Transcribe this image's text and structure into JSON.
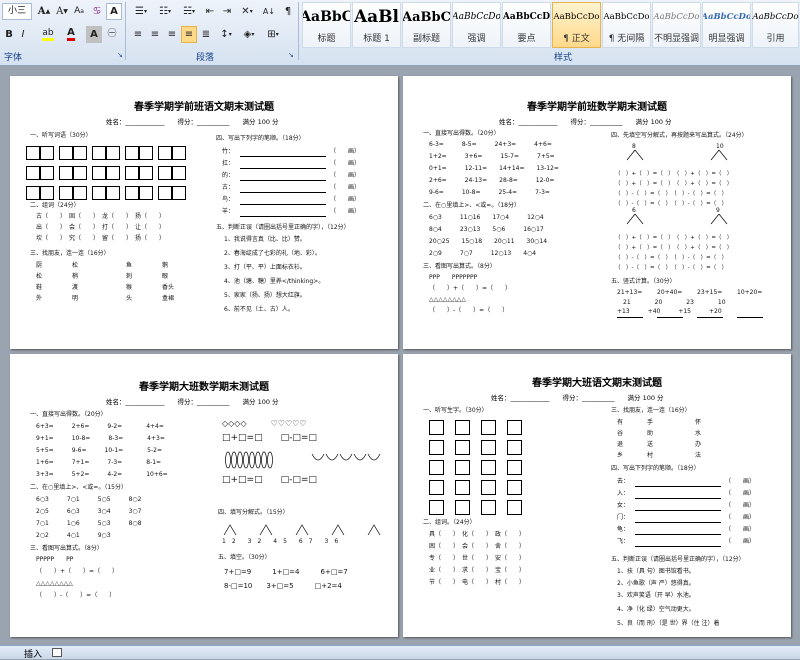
{
  "ribbon": {
    "font_size": "小三",
    "group_font": "字体",
    "group_paragraph": "段落",
    "group_styles": "样式",
    "styles": [
      {
        "preview": "AaBbC",
        "name": "标题"
      },
      {
        "preview": "AaBl",
        "name": "标题 1"
      },
      {
        "preview": "AaBbC",
        "name": "副标题"
      },
      {
        "preview": "AaBbCcDo",
        "name": "强调"
      },
      {
        "preview": "AaBbCcD",
        "name": "要点"
      },
      {
        "preview": "AaBbCcDo",
        "name": "正文"
      },
      {
        "preview": "AaBbCcDo",
        "name": "无间隔"
      },
      {
        "preview": "AaBbCcDo",
        "name": "不明显强调"
      },
      {
        "preview": "AaBbCcDo",
        "name": "明显强调"
      },
      {
        "preview": "AaBbCcDo",
        "name": "引用"
      }
    ],
    "selected_style": "正文"
  },
  "status": {
    "insert": "插入"
  },
  "page1": {
    "title": "春季学期学前班语文期末测试题",
    "info": [
      "姓名：",
      "得分：",
      "满分 100 分"
    ],
    "s1": "一、听写词语（30分）",
    "s2": "二、组词（24分）",
    "s2_rows": [
      "古（　　）　固（　　）　龙（　　）　扬（　　）",
      "出（　　）　会（　　）　打（　　）　让（　　）",
      "坎（　　）　究（　　）　留（　　）　扬（　　）"
    ],
    "s3": "三、找朋友，连一连（16分）",
    "s3_left": [
      "厨　　　　　松",
      "松　　　　　梢",
      "鞋　　　　　渡",
      "外　　　　　明"
    ],
    "s3_right": [
      "鱼　　　　　鹅",
      "刺　　　　　眼",
      "猴　　　　　香头",
      "头　　　　　盒裙"
    ],
    "s4": "四、写出下列字的笔顺。（18分）",
    "s4_chars": [
      "竹：",
      "扛：",
      "的：",
      "古：",
      "鸟：",
      "羊："
    ],
    "s4_tail": "（　　画）",
    "s5": "五、判断正误（请圈出括号里正确的字），（12分）",
    "s5_rows": [
      "1、我说得言真（比、比）赞。",
      "2、春海绽成了七彩的礼（地、彩）。",
      "3、打（平、平）上面标衣衫。",
      "4、池（塘、糖）里养</thinking>。",
      "5、家家（扬、扬）想大红旗。",
      "6、前不见（土、古）人。"
    ]
  },
  "page2": {
    "title": "春季学期学前班数学期末测试题",
    "info": [
      "姓名：",
      "得分：",
      "满分 100 分"
    ],
    "s1": "一、直接写出得数。（20分）",
    "s1_rows": [
      "6-3=　　　8-5=　　　24+3=　　　4+6=",
      "1+2=　　　3+6=　　　15-7=　　　7+5=",
      "0+1=　　　12-11=　　14+14=　　13-12=",
      "2+6=　　　24-13=　　28-8=　　　12-0=",
      "9-6=　　　10-8=　　　25-4=　　　7-3="
    ],
    "s2": "二、在○里填上>、<或=。（18分）",
    "s2_rows": [
      "6○3　　　11○16　　17○4　　　12○4",
      "8○4　　　23○13　　5○6　　　16○17",
      "20○25　　15○18　　20○11　　30○14",
      "2○9　　　7○7　　　12○13　　4○4"
    ],
    "s3": "三、看图写出算式。（8分）",
    "s3_rows": [
      "PPP　　PPPPPPP",
      "（　　）+（　　）=（　　）",
      "△△△△△△△△",
      "（　　）-（　　）=（　　）"
    ],
    "s4": "四、先填空写分解式，再按题来写出算式。（24分）",
    "s4_tops": [
      "8",
      "10",
      "6",
      "9"
    ],
    "s4_rows": [
      "（　）+（　）=（　）　（　）+（　）=（　）",
      "（　）+（　）=（　）　（　）+（　）=（　）",
      "（　）-（　）=（　）　（　）-（　）=（　）",
      "（　）-（　）=（　）　（　）-（　）=（　）"
    ],
    "s5": "五、竖式计算。（30分）",
    "s5_a": [
      "21+13=",
      "20+40=",
      "23+15=",
      "10+20="
    ],
    "s5_b": [
      "21　　　　20　　　　23　　　　10",
      "+13　　　+40　　　+15　　　+20"
    ]
  },
  "page3": {
    "title": "春季学期大班数学期末测试题",
    "info": [
      "姓名：",
      "得分：",
      "满分 100 分"
    ],
    "s1": "一、直接写出得数。（20分）",
    "s1_rows": [
      "6+3=　　　2+6=　　　9-2=　　　　4+4=",
      "9+1=　　　10-8=　　　8-3=　　　　4+3=",
      "5+5=　　　9-6=　　　10-1=　　　　5-2=",
      "1+6=　　　7+1=　　　7-3=　　　　8-1=",
      "3+3=　　　5+2=　　　4-2=　　　　10+6="
    ],
    "s2": "二、在○里填上>、<或=。（15分）",
    "s2_rows": [
      "6○3　　　7○1　　　5○5　　　8○2",
      "2○5　　　6○3　　　3○4　　　3○7",
      "7○1　　　1○6　　　5○3　　　8○8",
      "2○2　　　4○1　　　9○3"
    ],
    "s3": "三、看图写出算式。（8分）",
    "s3_rows": [
      "PPPPP　　PP",
      "（　　）+（　　）=（　　）",
      "△△△△△△△△",
      "（　　）-（　　）=（　　）"
    ],
    "fig_rows": [
      "◇◇◇◇　　　♡♡♡♡♡",
      "□+□=□　　□-□=□"
    ],
    "s4": "四、填写分解式。（15分）",
    "s4_nums": [
      "1　2　　3　2　　4　5　　6　7　　3　6"
    ],
    "s5": "五、填空。（30分）",
    "s5_rows": [
      "7+□=9　　　1+□=4　　　6+□=7",
      "8-□=10　　3+□=5　　　□+2=4"
    ]
  },
  "page4": {
    "title": "春季学期大班语文期末测试题",
    "info": [
      "姓名：",
      "得分：",
      "满分 100 分"
    ],
    "s1": "一、听写生字。（30分）",
    "s2": "二、组词。（24分）",
    "s2_rows": [
      "具（　　）　化（　　）　政（　　）",
      "困（　　）　会（　　）　舍（　　）",
      "专（　　）　世（　　）　安（　　）",
      "业（　　）　求（　　）　宝（　　）",
      "节（　　）　电（　　）　村（　　）"
    ],
    "s3": "三、找朋友，连一连（16分）",
    "s3_rows": [
      "有　　　　手　　　　　　　怀",
      "谷　　　　助　　　　　　　水",
      "退　　　　送　　　　　　　办",
      "乡　　　　村　　　　　　　法"
    ],
    "s4": "四、写出下列字的笔顺。（18分）",
    "s4_chars": [
      "去：",
      "入：",
      "女：",
      "门：",
      "龟：",
      "飞："
    ],
    "s4_tail": "（　　画）",
    "s5": "五、判断正误（请圈出括号里正确的字），（12分）",
    "s5_rows": [
      "1、扶（具 句）图书馆看书。",
      "2、小鱼歌（声 严）悠得真。",
      "3、欢声笑语（开 早）水池。",
      "4、净（化 绿）空气动更大。",
      "5、良（而 刑）（是 世）界（住 注）着"
    ]
  }
}
